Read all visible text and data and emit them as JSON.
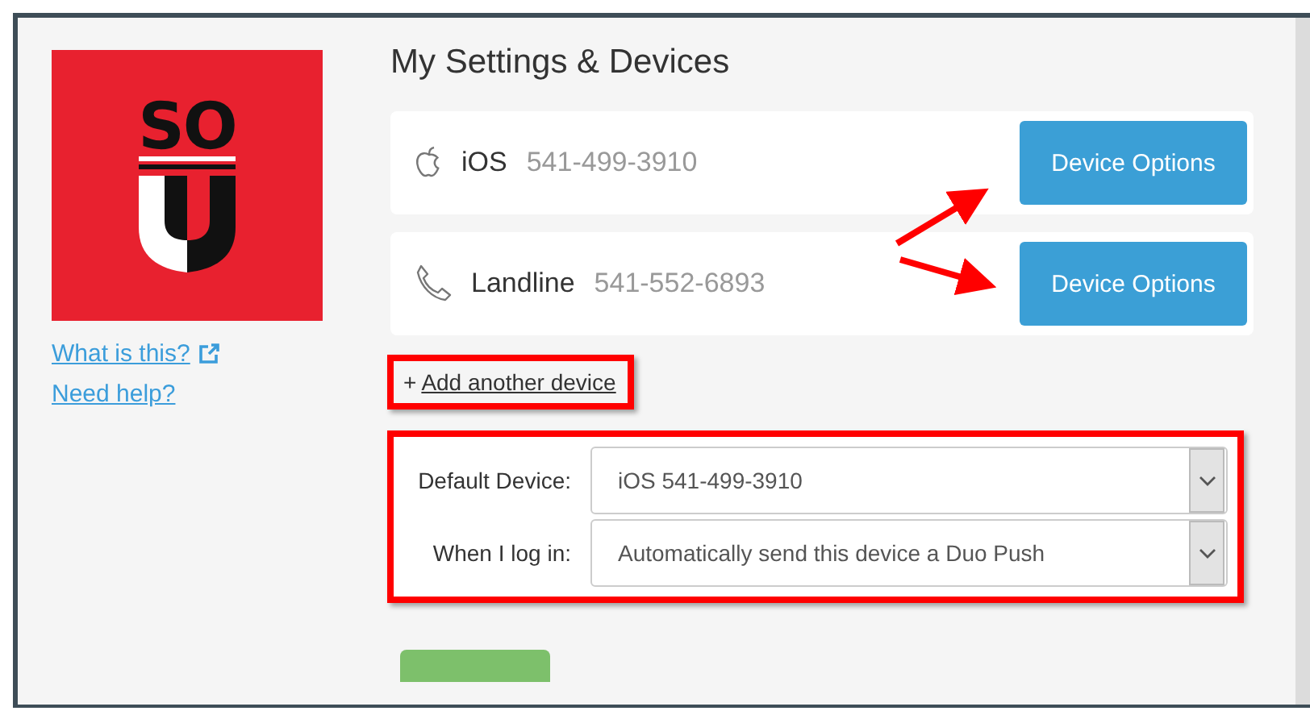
{
  "logo": {
    "text": "SO"
  },
  "side_links": [
    {
      "label": "What is this?",
      "external": true
    },
    {
      "label": "Need help?",
      "external": false
    }
  ],
  "title": "My Settings & Devices",
  "devices": [
    {
      "kind": "phone",
      "name": "iOS",
      "number": "541-499-3910",
      "button": "Device Options"
    },
    {
      "kind": "landline",
      "name": "Landline",
      "number": "541-552-6893",
      "button": "Device Options"
    }
  ],
  "add_device": {
    "prefix": "+",
    "label": "Add another device"
  },
  "settings": [
    {
      "label": "Default Device:",
      "value": "iOS 541-499-3910"
    },
    {
      "label": "When I log in:",
      "value": "Automatically send this device a Duo Push"
    }
  ],
  "annotations": {
    "highlight_add": true,
    "highlight_settings": true,
    "arrows": true
  }
}
